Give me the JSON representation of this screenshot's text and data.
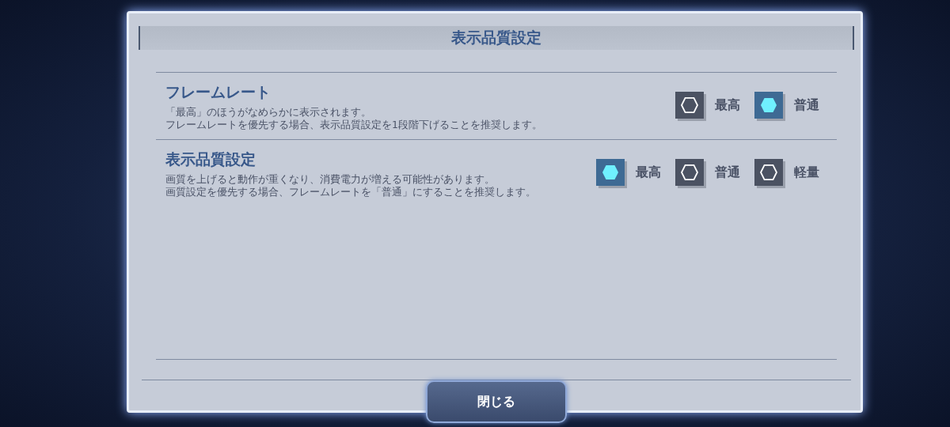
{
  "dialog": {
    "title": "表示品質設定"
  },
  "settings": [
    {
      "heading": "フレームレート",
      "description": [
        "「最高」のほうがなめらかに表示されます。",
        "フレームレートを優先する場合、表示品質設定を1段階下げることを推奨します。"
      ],
      "options": [
        {
          "label": "最高",
          "selected": false
        },
        {
          "label": "普通",
          "selected": true
        }
      ]
    },
    {
      "heading": "表示品質設定",
      "description": [
        "画質を上げると動作が重くなり、消費電力が増える可能性があります。",
        "画質設定を優先する場合、フレームレートを「普通」にすることを推奨します。"
      ],
      "options": [
        {
          "label": "最高",
          "selected": true
        },
        {
          "label": "普通",
          "selected": false
        },
        {
          "label": "軽量",
          "selected": false
        }
      ]
    }
  ],
  "close_button": {
    "label": "閉じる"
  }
}
